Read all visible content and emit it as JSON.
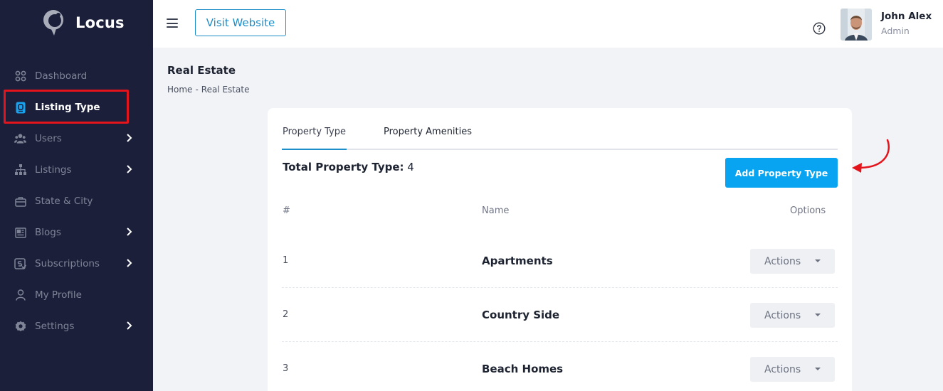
{
  "app": {
    "name": "Locus"
  },
  "sidebar": {
    "items": [
      {
        "label": "Dashboard",
        "icon": "grid-icon",
        "has_submenu": false,
        "active": false
      },
      {
        "label": "Listing Type",
        "icon": "document-icon",
        "has_submenu": false,
        "active": true
      },
      {
        "label": "Users",
        "icon": "users-icon",
        "has_submenu": true,
        "active": false
      },
      {
        "label": "Listings",
        "icon": "sitemap-icon",
        "has_submenu": true,
        "active": false
      },
      {
        "label": "State & City",
        "icon": "briefcase-icon",
        "has_submenu": false,
        "active": false
      },
      {
        "label": "Blogs",
        "icon": "newspaper-icon",
        "has_submenu": true,
        "active": false
      },
      {
        "label": "Subscriptions",
        "icon": "subscription-icon",
        "has_submenu": true,
        "active": false
      },
      {
        "label": "My Profile",
        "icon": "user-icon",
        "has_submenu": false,
        "active": false
      },
      {
        "label": "Settings",
        "icon": "gear-icon",
        "has_submenu": true,
        "active": false
      }
    ]
  },
  "header": {
    "visit_button": "Visit Website",
    "user": {
      "name": "John Alex",
      "role": "Admin"
    }
  },
  "page": {
    "title": "Real Estate",
    "breadcrumb": {
      "home": "Home",
      "separator": "-",
      "current": "Real Estate"
    }
  },
  "card": {
    "tabs": [
      {
        "label": "Property Type",
        "active": true
      },
      {
        "label": "Property Amenities",
        "active": false
      }
    ],
    "total_label": "Total Property Type:",
    "total_value": "4",
    "add_button": "Add Property Type",
    "table": {
      "headers": {
        "number": "#",
        "name": "Name",
        "options": "Options"
      },
      "rows": [
        {
          "num": "1",
          "name": "Apartments",
          "action": "Actions"
        },
        {
          "num": "2",
          "name": "Country Side",
          "action": "Actions"
        },
        {
          "num": "3",
          "name": "Beach Homes",
          "action": "Actions"
        }
      ]
    }
  },
  "colors": {
    "sidebar_bg": "#1b1f3a",
    "accent": "#1c8ec9",
    "button_primary": "#08a4f2",
    "annotation_red": "#e3141b"
  }
}
